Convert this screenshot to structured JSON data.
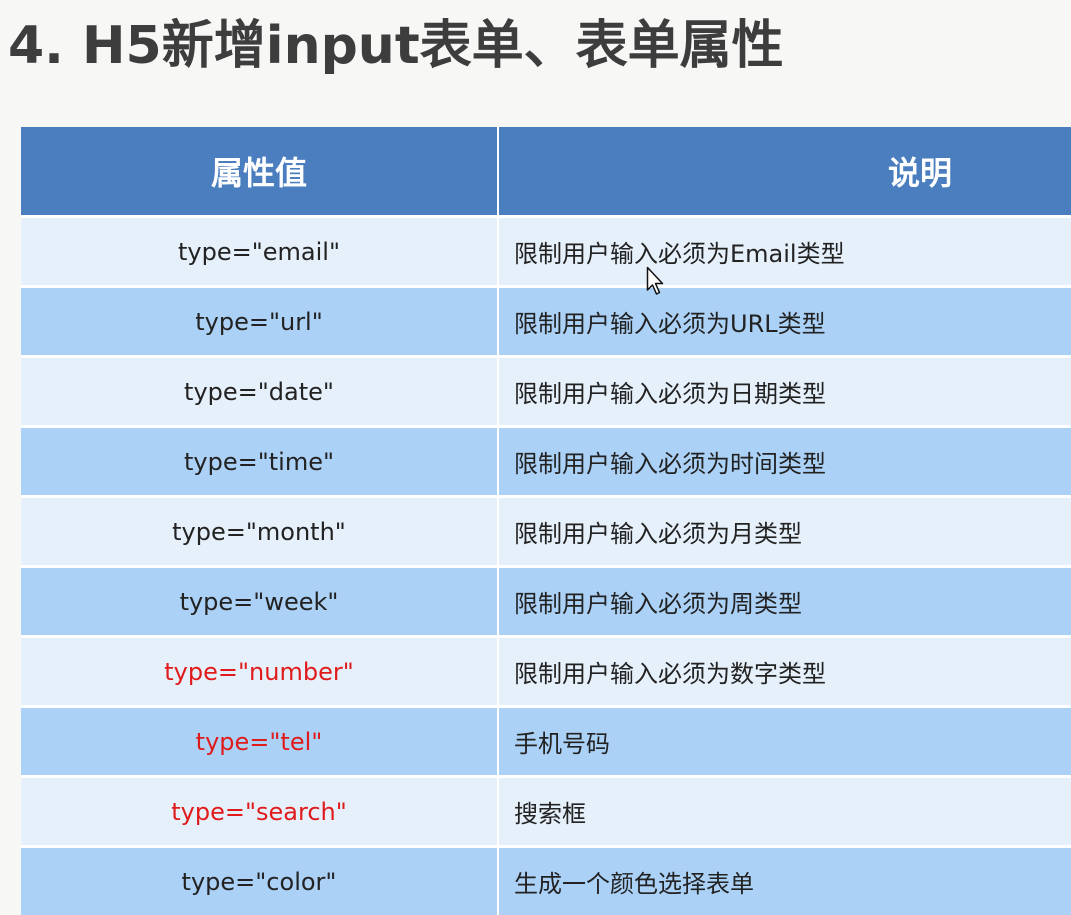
{
  "title": "4. H5新增input表单、表单属性",
  "table": {
    "headers": [
      "属性值",
      "说明"
    ],
    "rows": [
      {
        "attr": "type=\"email\"",
        "desc": "限制用户输入必须为Email类型",
        "highlight": false
      },
      {
        "attr": "type=\"url\"",
        "desc": "限制用户输入必须为URL类型",
        "highlight": false
      },
      {
        "attr": "type=\"date\"",
        "desc": "限制用户输入必须为日期类型",
        "highlight": false
      },
      {
        "attr": "type=\"time\"",
        "desc": "限制用户输入必须为时间类型",
        "highlight": false
      },
      {
        "attr": "type=\"month\"",
        "desc": "限制用户输入必须为月类型",
        "highlight": false
      },
      {
        "attr": "type=\"week\"",
        "desc": "限制用户输入必须为周类型",
        "highlight": false
      },
      {
        "attr": "type=\"number\"",
        "desc": "限制用户输入必须为数字类型",
        "highlight": true
      },
      {
        "attr": "type=\"tel\"",
        "desc": "手机号码",
        "highlight": true
      },
      {
        "attr": "type=\"search\"",
        "desc": "搜索框",
        "highlight": true
      },
      {
        "attr": "type=\"color\"",
        "desc": "生成一个颜色选择表单",
        "highlight": false
      }
    ]
  },
  "colors": {
    "header_bg": "#4a7ebf",
    "row_light": "#e6f0fa",
    "row_dark": "#abd1f6",
    "highlight_text": "#e01b1b",
    "title_text": "#3d3d3d"
  },
  "icons": {
    "cursor": "mouse-pointer-icon"
  }
}
